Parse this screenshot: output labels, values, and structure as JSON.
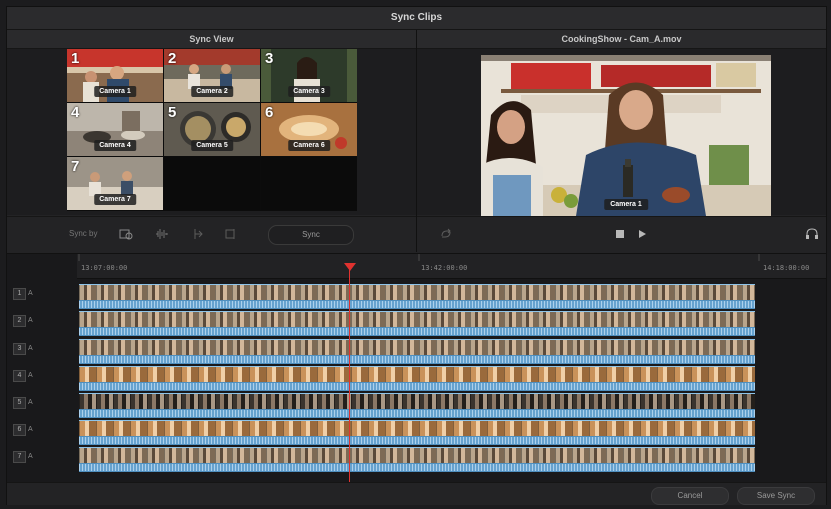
{
  "window": {
    "title": "Sync Clips"
  },
  "left_panel": {
    "title": "Sync View"
  },
  "right_panel": {
    "title": "CookingShow - Cam_A.mov"
  },
  "multicam": {
    "cells": [
      {
        "num": "1",
        "label": "Camera 1",
        "selected": true
      },
      {
        "num": "2",
        "label": "Camera 2"
      },
      {
        "num": "3",
        "label": "Camera 3"
      },
      {
        "num": "4",
        "label": "Camera 4"
      },
      {
        "num": "5",
        "label": "Camera 5"
      },
      {
        "num": "6",
        "label": "Camera 6"
      },
      {
        "num": "7",
        "label": "Camera 7"
      }
    ]
  },
  "viewer": {
    "camera_label": "Camera 1"
  },
  "toolbar": {
    "sync_by_label": "Sync by",
    "sync_button": "Sync",
    "icons": [
      "timecode-icon",
      "waveform-icon",
      "in-point-icon",
      "out-point-icon"
    ]
  },
  "transport": {
    "icons": [
      "loop-icon",
      "stop-icon",
      "play-icon",
      "headphones-icon"
    ]
  },
  "timeline": {
    "timecodes": [
      "13:07:00:00",
      "13:42:00:00",
      "14:18:00:00"
    ],
    "tracks": [
      {
        "num": "1",
        "suffix": "A"
      },
      {
        "num": "2",
        "suffix": "A"
      },
      {
        "num": "3",
        "suffix": "A"
      },
      {
        "num": "4",
        "suffix": "A"
      },
      {
        "num": "5",
        "suffix": "A"
      },
      {
        "num": "6",
        "suffix": "A"
      },
      {
        "num": "7",
        "suffix": "A"
      }
    ]
  },
  "footer": {
    "cancel": "Cancel",
    "save": "Save Sync"
  },
  "colors": {
    "accent": "#e0322f",
    "clip": "#4f8fbf",
    "selected_outline": "#e5484d"
  }
}
